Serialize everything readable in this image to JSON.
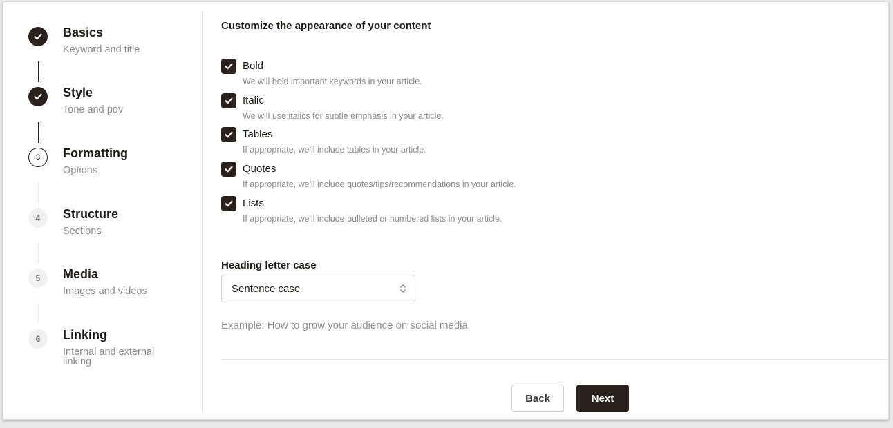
{
  "stepper": {
    "steps": [
      {
        "title": "Basics",
        "subtitle": "Keyword and title",
        "state": "done",
        "number": "1"
      },
      {
        "title": "Style",
        "subtitle": "Tone and pov",
        "state": "done",
        "number": "2"
      },
      {
        "title": "Formatting",
        "subtitle": "Options",
        "state": "current",
        "number": "3"
      },
      {
        "title": "Structure",
        "subtitle": "Sections",
        "state": "pending",
        "number": "4"
      },
      {
        "title": "Media",
        "subtitle": "Images and videos",
        "state": "pending",
        "number": "5"
      },
      {
        "title": "Linking",
        "subtitle": "Internal and external linking",
        "state": "pending",
        "number": "6"
      }
    ]
  },
  "main": {
    "section_title": "Customize the appearance of your content",
    "options": [
      {
        "label": "Bold",
        "description": "We will bold important keywords in your article.",
        "checked": true
      },
      {
        "label": "Italic",
        "description": "We will use italics for subtle emphasis in your article.",
        "checked": true
      },
      {
        "label": "Tables",
        "description": "If appropriate, we'll include tables in your article.",
        "checked": true
      },
      {
        "label": "Quotes",
        "description": "If appropriate, we'll include quotes/tips/recommendations in your article.",
        "checked": true
      },
      {
        "label": "Lists",
        "description": "If appropriate, we'll include bulleted or numbered lists in your article.",
        "checked": true
      }
    ],
    "heading_case": {
      "label": "Heading letter case",
      "selected": "Sentence case",
      "example": "Example: How to grow your audience on social media"
    }
  },
  "footer": {
    "back_label": "Back",
    "next_label": "Next"
  },
  "colors": {
    "primary": "#2a201c",
    "muted_text": "#8a8a8a",
    "border": "#cfcfcf"
  }
}
